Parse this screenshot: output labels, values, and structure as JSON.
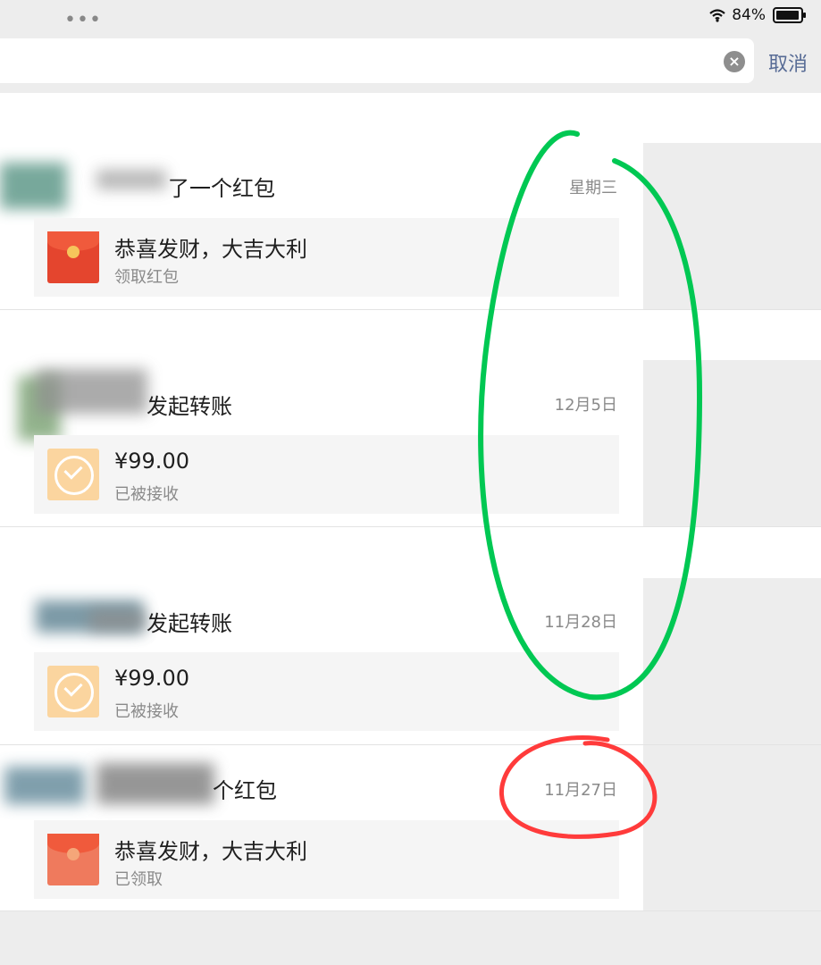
{
  "status": {
    "dots": "•••",
    "battery": "84%"
  },
  "search": {
    "cancel": "取消",
    "clear": "×"
  },
  "records": [
    {
      "title": "了一个红包",
      "date": "星期三",
      "type": "red-packet",
      "card_title": "恭喜发财，大吉大利",
      "card_status": "领取红包"
    },
    {
      "title": "发起转账",
      "date": "12月5日",
      "type": "transfer",
      "card_title": "¥99.00",
      "card_status": "已被接收"
    },
    {
      "title": "发起转账",
      "date": "11月28日",
      "type": "transfer",
      "card_title": "¥99.00",
      "card_status": "已被接收"
    },
    {
      "title": "个红包",
      "date": "11月27日",
      "type": "red-packet-opened",
      "card_title": "恭喜发财，大吉大利",
      "card_status": "已领取"
    }
  ],
  "annotations": {
    "green": "#00c853",
    "red": "#ff3b3b"
  }
}
